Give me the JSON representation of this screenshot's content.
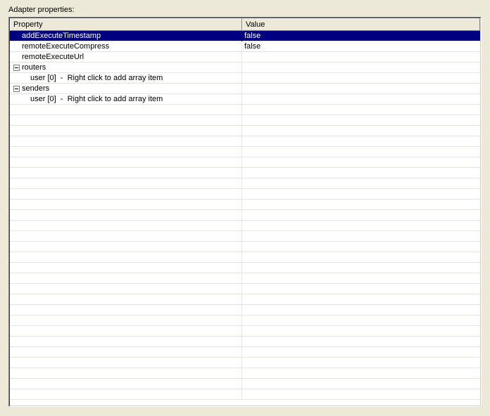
{
  "panel": {
    "label": "Adapter properties:",
    "columns": {
      "property": "Property",
      "value": "Value"
    }
  },
  "rows": [
    {
      "kind": "leaf",
      "indent": 14,
      "selected": true,
      "name": "addExecuteTimestamp",
      "value": "false"
    },
    {
      "kind": "leaf",
      "indent": 14,
      "selected": false,
      "name": "remoteExecuteCompress",
      "value": "false"
    },
    {
      "kind": "leaf",
      "indent": 14,
      "selected": false,
      "name": "remoteExecuteUrl",
      "value": ""
    },
    {
      "kind": "group",
      "indent": 2,
      "selected": false,
      "expanded": true,
      "name": "routers",
      "value": ""
    },
    {
      "kind": "leaf",
      "indent": 26,
      "selected": false,
      "name": "user [0]  -  Right click to add array item",
      "value": ""
    },
    {
      "kind": "group",
      "indent": 2,
      "selected": false,
      "expanded": true,
      "name": "senders",
      "value": ""
    },
    {
      "kind": "leaf",
      "indent": 26,
      "selected": false,
      "name": "user [0]  -  Right click to add array item",
      "value": ""
    }
  ],
  "emptyRowCount": 28
}
